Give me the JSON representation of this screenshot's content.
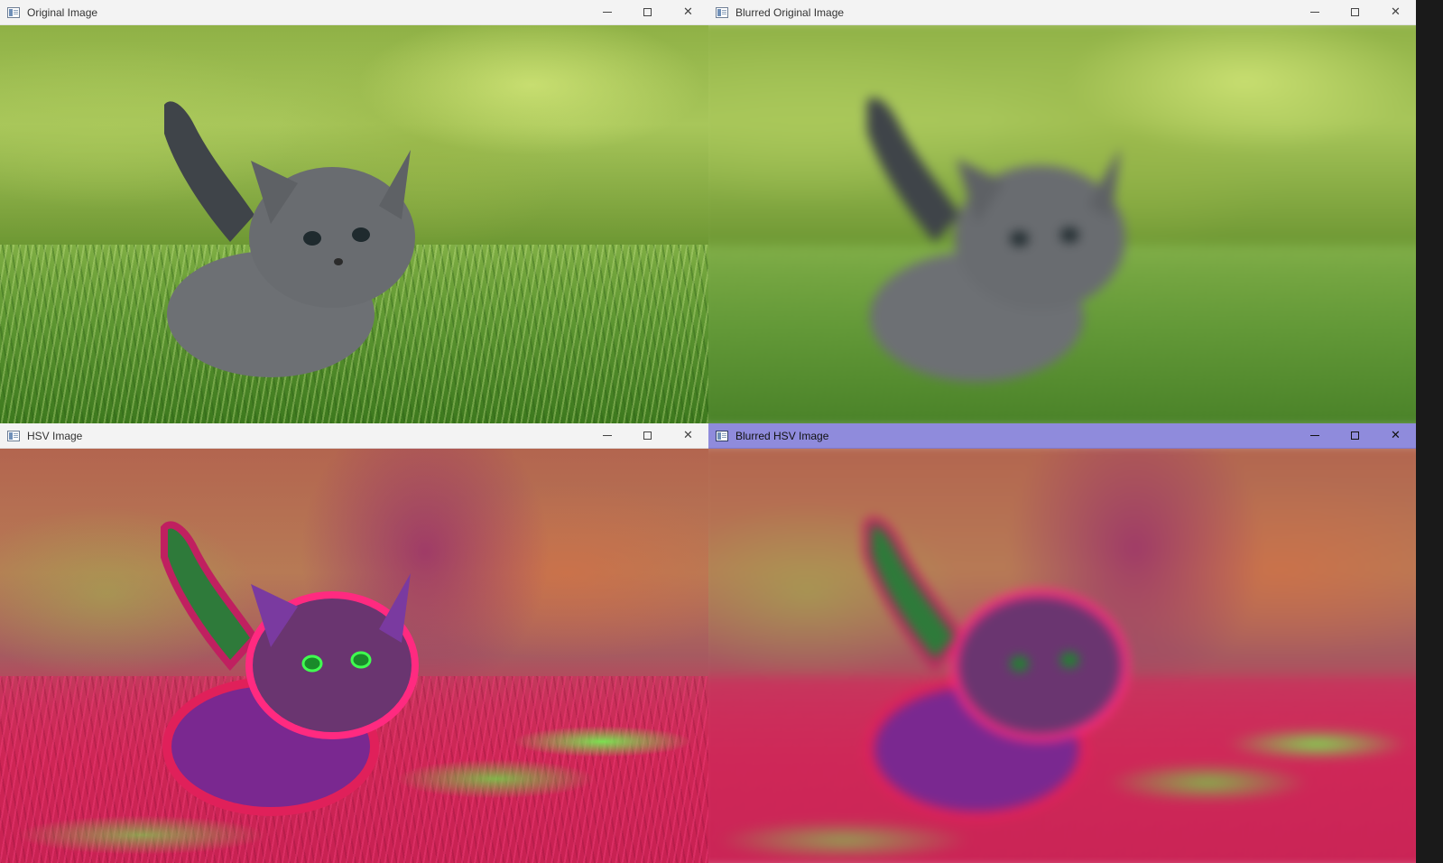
{
  "windows": [
    {
      "title": "Original Image",
      "active": false,
      "style": "natural",
      "blurred": false
    },
    {
      "title": "Blurred Original Image",
      "active": false,
      "style": "natural",
      "blurred": true
    },
    {
      "title": "HSV Image",
      "active": false,
      "style": "hsv",
      "blurred": false
    },
    {
      "title": "Blurred HSV Image",
      "active": true,
      "style": "hsv",
      "blurred": true
    }
  ],
  "controls": {
    "minimize_icon": "minimize-icon",
    "maximize_icon": "maximize-icon",
    "close_label": "✕"
  },
  "colors": {
    "active_titlebar": "#8f8bdc",
    "inactive_titlebar": "#f3f3f3"
  }
}
